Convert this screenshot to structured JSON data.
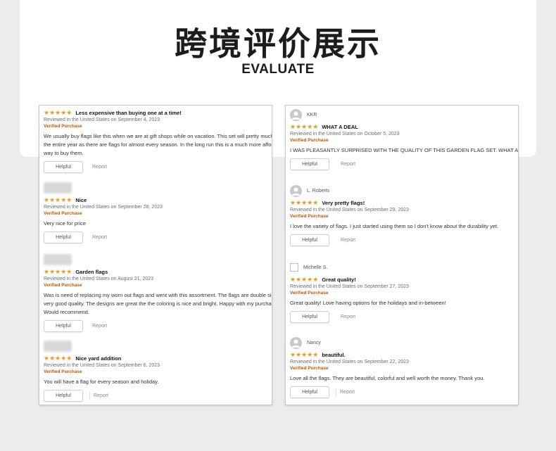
{
  "header": {
    "title": "跨境评价展示",
    "subtitle": "EVALUATE"
  },
  "colors": {
    "star": "#f29a17",
    "verified": "#c45500"
  },
  "left_panel": {
    "reviews": [
      {
        "author": "",
        "stars": "★★★★★",
        "title": "Less expensive than buying one at a time!",
        "date": "Reviewed in the United States on September 4, 2023",
        "verified": "Verified Purchase",
        "body": [
          "We usually buy flags like this when we are at gift shops while on vacation. This set will pretty much last us",
          "the entire year as there are flags for almost every season. In the long run this is a much more affordable",
          "way to buy them."
        ],
        "helpful": "Helpful",
        "report": "Report"
      },
      {
        "author": "",
        "stars": "★★★★★",
        "title": "Nice",
        "date": "Reviewed in the United States on September 28, 2023",
        "verified": "Verified Purchase",
        "body": [
          "Very nice for price"
        ],
        "helpful": "Helpful",
        "report": "Report"
      },
      {
        "author": "",
        "stars": "★★★★★",
        "title": "Garden flags",
        "date": "Reviewed in the United States on August 21, 2023",
        "verified": "Verified Purchase",
        "body": [
          "Was is need of replacing my worn out flags and went with this assortment. The flags are double sided and of",
          "very good quality. The designs are great the the coloring is nice and bright. Happy with my purchase.",
          "Would recommend."
        ],
        "helpful": "Helpful",
        "report": "Report"
      },
      {
        "author": "",
        "stars": "★★★★★",
        "title": "Nice yard addition",
        "date": "Reviewed in the United States on September 6, 2023",
        "verified": "Verified Purchase",
        "body": [
          "You will have a flag for every season and holiday."
        ],
        "helpful": "Helpful",
        "report": "Report"
      }
    ]
  },
  "right_panel": {
    "reviews": [
      {
        "author": "KKR",
        "stars": "★★★★★",
        "title": "WHAT A DEAL",
        "date": "Reviewed in the United States on October 5, 2023",
        "verified": "Verified Purchase",
        "body": [
          "I WAS PLEASANTLY SURPRISED WITH THE QUALITY OF THIS GARDEN FLAG SET. WHAT A DEAL!"
        ],
        "helpful": "Helpful",
        "report": "Report"
      },
      {
        "author": "L. Roberts",
        "stars": "★★★★★",
        "title": "Very pretty flags!",
        "date": "Reviewed in the United States on September 29, 2023",
        "verified": "Verified Purchase",
        "body": [
          "I love the variety of flags. I just started using them so I don't know about the durability yet."
        ],
        "helpful": "Helpful",
        "report": "Report"
      },
      {
        "author": "Michelle S.",
        "stars": "★★★★★",
        "title": "Great quality!",
        "date": "Reviewed in the United States on September 27, 2023",
        "verified": "Verified Purchase",
        "body": [
          "Great quality! Love having options for the holidays and in-between!"
        ],
        "helpful": "Helpful",
        "report": "Report"
      },
      {
        "author": "Nancy",
        "stars": "★★★★★",
        "title": "beautiful.",
        "date": "Reviewed in the United States on September 22, 2023",
        "verified": "Verified Purchase",
        "body": [
          "Love all the flags. They are beautiful, colorful and well worth the money. Thank you."
        ],
        "helpful": "Helpful",
        "report": "Report"
      }
    ]
  }
}
